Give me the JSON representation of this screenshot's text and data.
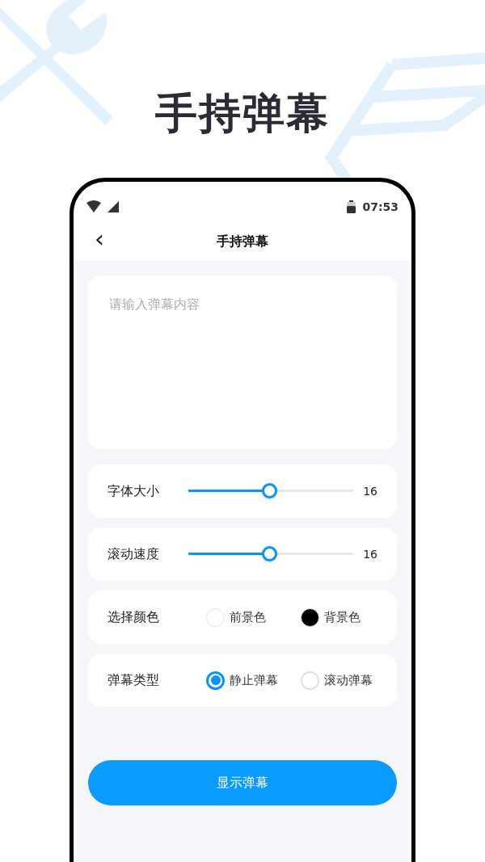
{
  "headline": "手持弹幕",
  "status_bar": {
    "time": "07:53"
  },
  "nav": {
    "back": "‹",
    "title": "手持弹幕"
  },
  "message": {
    "placeholder": "请输入弹幕内容"
  },
  "sliders": [
    {
      "label": "字体大小",
      "level": 0.49,
      "reading": "16"
    },
    {
      "label": "滚动速度",
      "level": 0.49,
      "reading": "16"
    }
  ],
  "colors": {
    "label": "选择颜色",
    "options": [
      {
        "label": "前景色",
        "color": "#ffffff"
      },
      {
        "label": "背景色",
        "color": "#000000"
      }
    ]
  },
  "type": {
    "label": "弹幕类型",
    "options": [
      {
        "label": "静止弹幕",
        "selected": true
      },
      {
        "label": "滚动弹幕",
        "selected": false
      }
    ]
  },
  "button": "显示弹幕"
}
